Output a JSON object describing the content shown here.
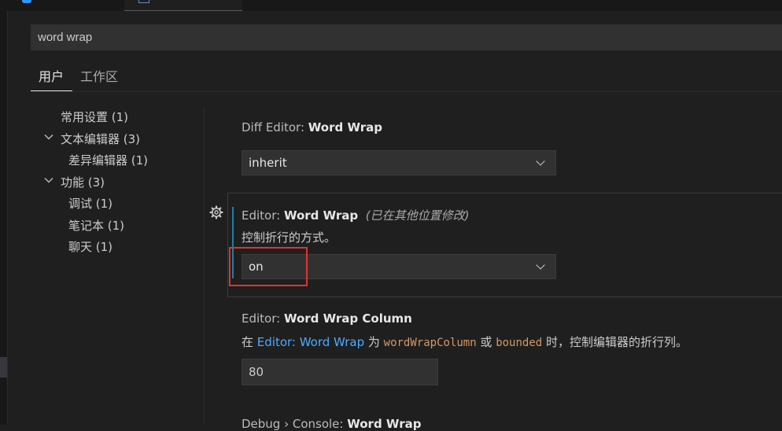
{
  "search": {
    "value": "word wrap"
  },
  "scope_tabs": {
    "user": "用户",
    "workspace": "工作区"
  },
  "toc": {
    "common": "常用设置 (1)",
    "text_editor": "文本编辑器 (3)",
    "diff_editor": "差异编辑器 (1)",
    "features": "功能 (3)",
    "debug": "调试 (1)",
    "notebook": "笔记本 (1)",
    "chat": "聊天 (1)"
  },
  "settings": {
    "diff_word_wrap": {
      "category": "Diff Editor: ",
      "name": "Word Wrap",
      "value": "inherit"
    },
    "editor_word_wrap": {
      "category": "Editor: ",
      "name": "Word Wrap",
      "modified_note": "(已在其他位置修改)",
      "description": "控制折行的方式。",
      "value": "on"
    },
    "editor_word_wrap_column": {
      "category": "Editor: ",
      "name": "Word Wrap Column",
      "desc_prefix": "在 ",
      "desc_link": "Editor: Word Wrap",
      "desc_mid1": " 为 ",
      "desc_code1": "wordWrapColumn",
      "desc_mid2": " 或 ",
      "desc_code2": "bounded",
      "desc_suffix": " 时，控制编辑器的折行列。",
      "value": "80"
    },
    "debug_console_word_wrap": {
      "category": "Debug › Console: ",
      "name": "Word Wrap"
    }
  },
  "icons": {
    "chevron": "chevron-down-icon",
    "gear": "gear-icon"
  },
  "colors": {
    "background": "#1f1f1f",
    "input_background": "#313131",
    "link": "#4daafc",
    "code": "#d19a66",
    "modified_indicator": "#1b81a8",
    "highlight_box": "#e5312f"
  }
}
